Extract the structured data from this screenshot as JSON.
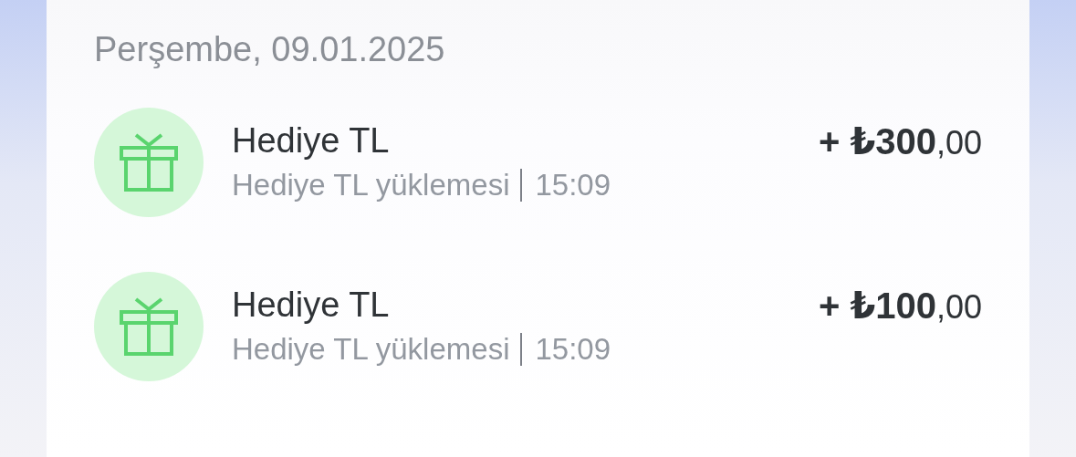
{
  "date_header": "Perşembe, 09.01.2025",
  "transactions": [
    {
      "title": "Hediye TL",
      "description": "Hediye TL yüklemesi",
      "time": "15:09",
      "amount": "**+ ₺300**,00"
    },
    {
      "title": "Hediye TL",
      "description": "Hediye TL yüklemesi",
      "time": "15:09",
      "amount": "**+ ₺100**,00"
    }
  ]
}
